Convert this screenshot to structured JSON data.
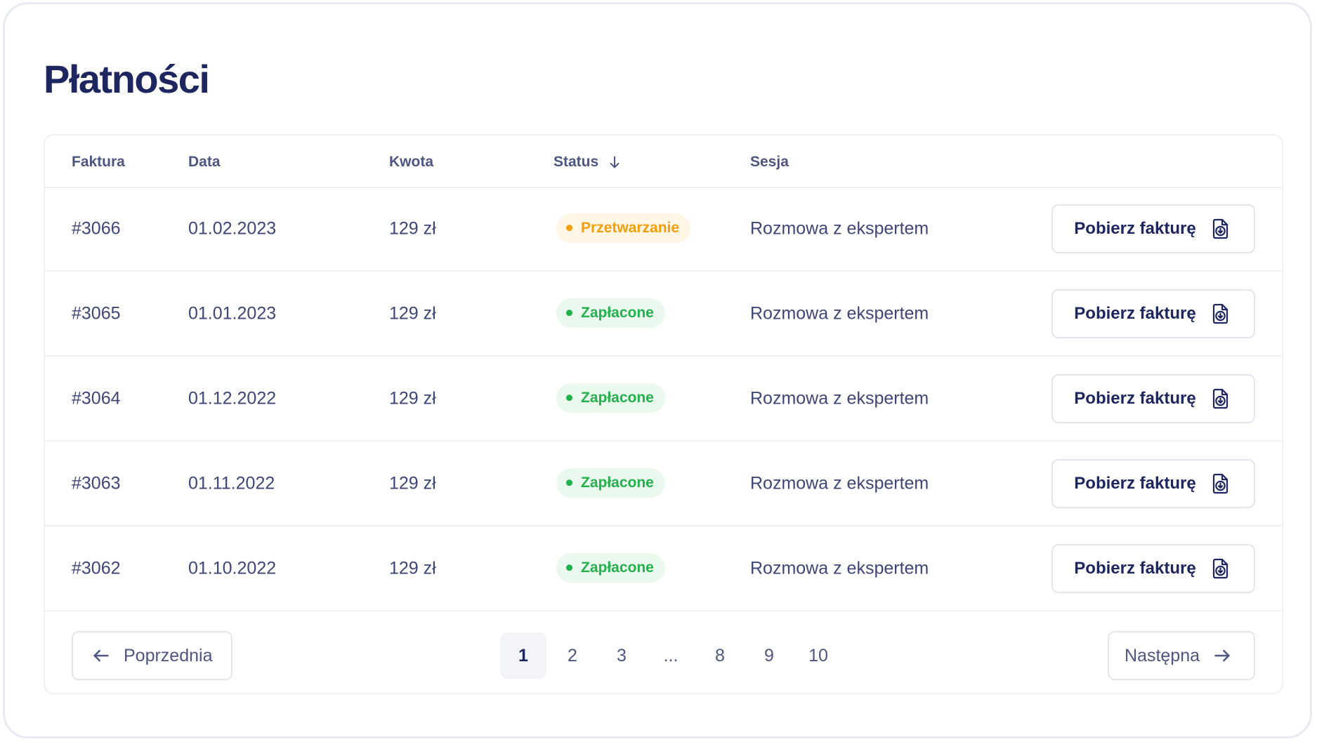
{
  "page": {
    "title": "Płatności"
  },
  "table": {
    "headers": {
      "invoice": "Faktura",
      "date": "Data",
      "amount": "Kwota",
      "status": "Status",
      "session": "Sesja"
    },
    "rows": [
      {
        "invoice": "#3066",
        "date": "01.02.2023",
        "amount": "129 zł",
        "status": "Przetwarzanie",
        "status_kind": "processing",
        "session": "Rozmowa z ekspertem",
        "action": "Pobierz fakturę"
      },
      {
        "invoice": "#3065",
        "date": "01.01.2023",
        "amount": "129 zł",
        "status": "Zapłacone",
        "status_kind": "paid",
        "session": "Rozmowa z ekspertem",
        "action": "Pobierz fakturę"
      },
      {
        "invoice": "#3064",
        "date": "01.12.2022",
        "amount": "129 zł",
        "status": "Zapłacone",
        "status_kind": "paid",
        "session": "Rozmowa z ekspertem",
        "action": "Pobierz fakturę"
      },
      {
        "invoice": "#3063",
        "date": "01.11.2022",
        "amount": "129 zł",
        "status": "Zapłacone",
        "status_kind": "paid",
        "session": "Rozmowa z ekspertem",
        "action": "Pobierz fakturę"
      },
      {
        "invoice": "#3062",
        "date": "01.10.2022",
        "amount": "129 zł",
        "status": "Zapłacone",
        "status_kind": "paid",
        "session": "Rozmowa z ekspertem",
        "action": "Pobierz fakturę"
      }
    ]
  },
  "pagination": {
    "prev_label": "Poprzednia",
    "next_label": "Następna",
    "pages": [
      "1",
      "2",
      "3",
      "...",
      "8",
      "9",
      "10"
    ],
    "current": "1"
  },
  "icons": {
    "sort": "arrow-down-icon",
    "download": "file-download-icon",
    "prev": "arrow-left-icon",
    "next": "arrow-right-icon"
  },
  "colors": {
    "title": "#1e2660",
    "processing": "#f59e0b",
    "paid": "#22b14c",
    "border": "#e3e5ee"
  }
}
